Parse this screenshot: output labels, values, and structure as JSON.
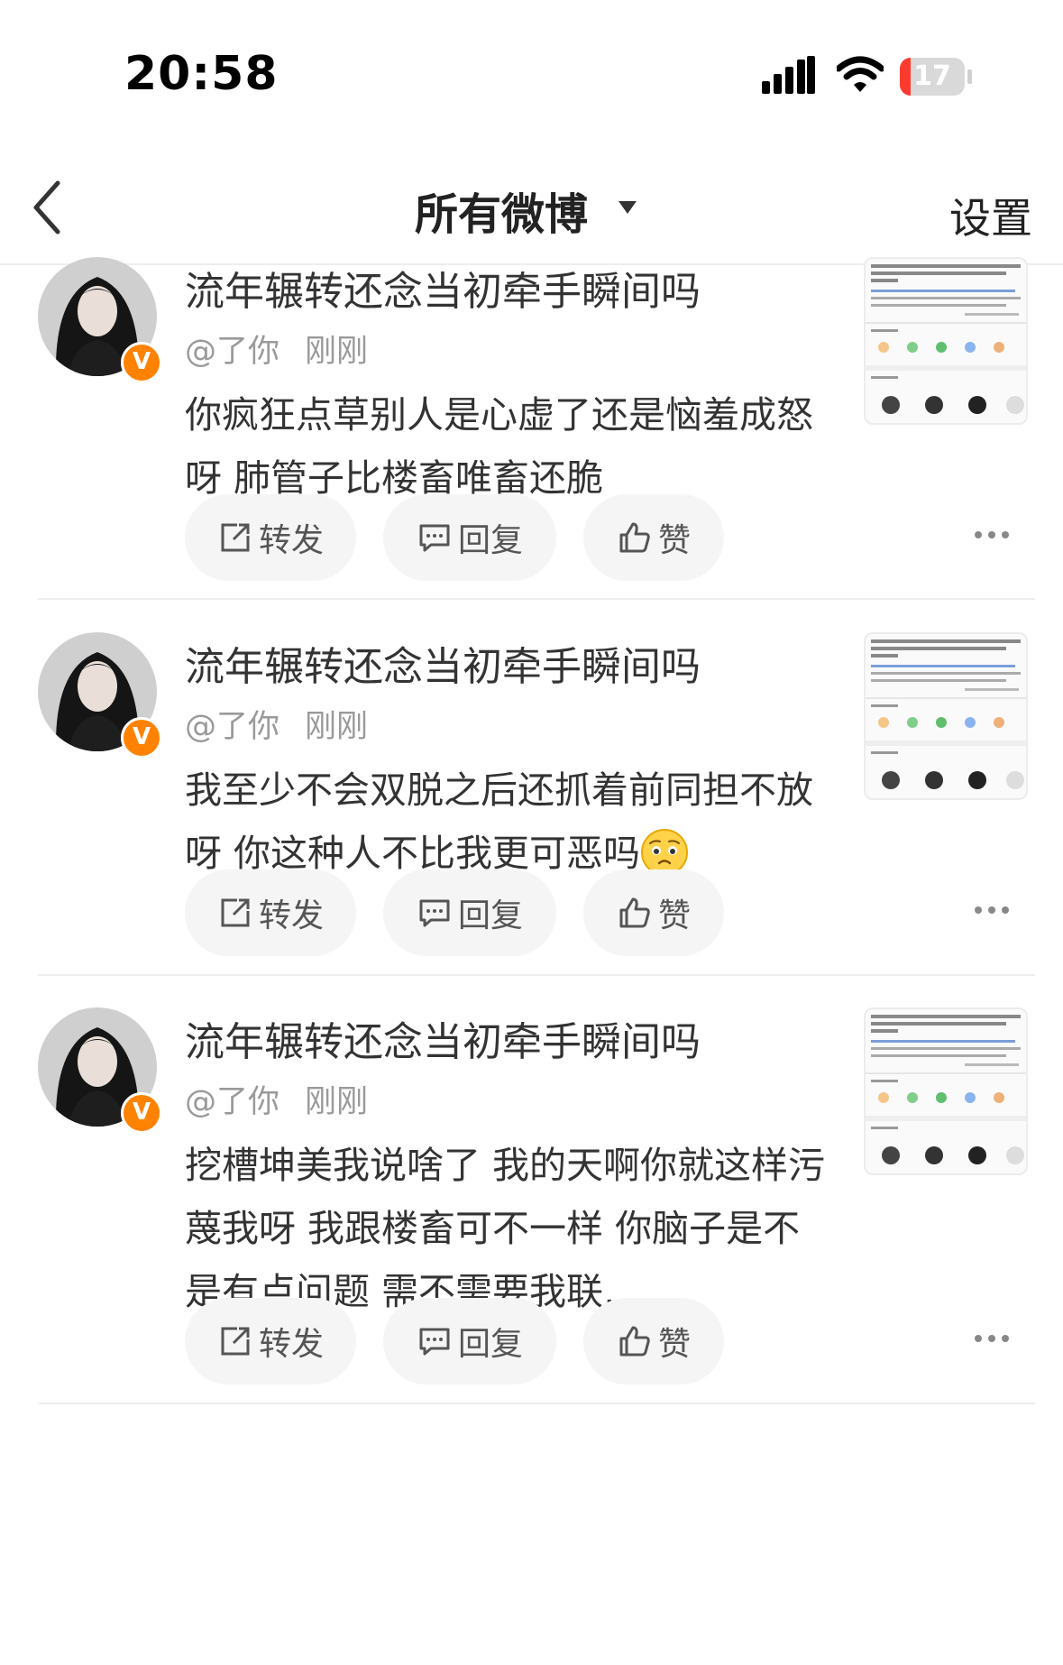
{
  "status_bar": {
    "time": "20:58",
    "battery": "17",
    "battery_level": 0.17
  },
  "navbar": {
    "title": "所有微博",
    "settings": "设置"
  },
  "verified_badge": "V",
  "colors": {
    "accent_orange": "#ff8200",
    "battery_red": "#ff3b30",
    "pill_bg": "#f5f5f5",
    "meta_gray": "#9a9a9a"
  },
  "posts": [
    {
      "title": "流年辗转还念当初牵手瞬间吗",
      "handle": "@了你",
      "time": "刚刚",
      "body": "你疯狂点草别人是心虚了还是恼羞成怒呀 肺管子比楼畜唯畜还脆",
      "has_emoji": false,
      "actions": {
        "repost": "转发",
        "reply": "回复",
        "like": "赞"
      }
    },
    {
      "title": "流年辗转还念当初牵手瞬间吗",
      "handle": "@了你",
      "time": "刚刚",
      "body": "我至少不会双脱之后还抓着前同担不放呀 你这种人不比我更可恶吗",
      "has_emoji": true,
      "actions": {
        "repost": "转发",
        "reply": "回复",
        "like": "赞"
      }
    },
    {
      "title": "流年辗转还念当初牵手瞬间吗",
      "handle": "@了你",
      "time": "刚刚",
      "body": "挖槽坤美我说啥了 我的天啊你就这样污蔑我呀 我跟楼畜可不一样 你脑子是不是有点问题 需不需要我联…",
      "has_emoji": false,
      "actions": {
        "repost": "转发",
        "reply": "回复",
        "like": "赞"
      }
    }
  ]
}
